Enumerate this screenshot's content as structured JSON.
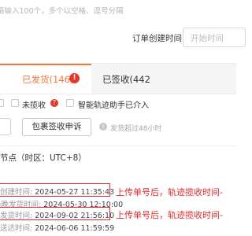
{
  "search": {
    "hint": "请输入100个，多个以空格、逗号分隔"
  },
  "filters": {
    "order_create_time_label": "订单创建时间",
    "start_time_placeholder": "开始时间"
  },
  "tabs": [
    {
      "label": "已发货(146)",
      "active": true,
      "alert": "!"
    },
    {
      "label": "已签收(442",
      "active": false
    }
  ],
  "checkboxes": [
    {
      "label": "未揽收",
      "checked": false
    },
    {
      "label": "智能轨迹助手已介入",
      "checked": false
    }
  ],
  "help_icon_glyph": "?",
  "actions": {
    "signing_complaint_label": "包裹签收申诉",
    "notice": "发货超过48小时"
  },
  "nodes": {
    "title": "节点（时区：UTC+8）",
    "rows": [
      {
        "key": "创建时间:",
        "value": "2024-05-27 11:35:43",
        "highlight": true
      },
      {
        "key": "最晚发货时间:",
        "value": "2024-05-30 12:10:00",
        "highlight": false
      },
      {
        "key": "发货时间:",
        "value": "2024-09-02 21:56:10",
        "highlight": true
      },
      {
        "key": "送达时间:",
        "value": "2024-06-06 11:59:59",
        "highlight": false
      }
    ]
  },
  "annotations": [
    "上传单号后，轨迹揽收时间-",
    "上传单号后，轨迹揽收时间-"
  ],
  "colors": {
    "accent": "#f0793c",
    "alert": "#e2372b",
    "annotation": "#d82b2b"
  }
}
